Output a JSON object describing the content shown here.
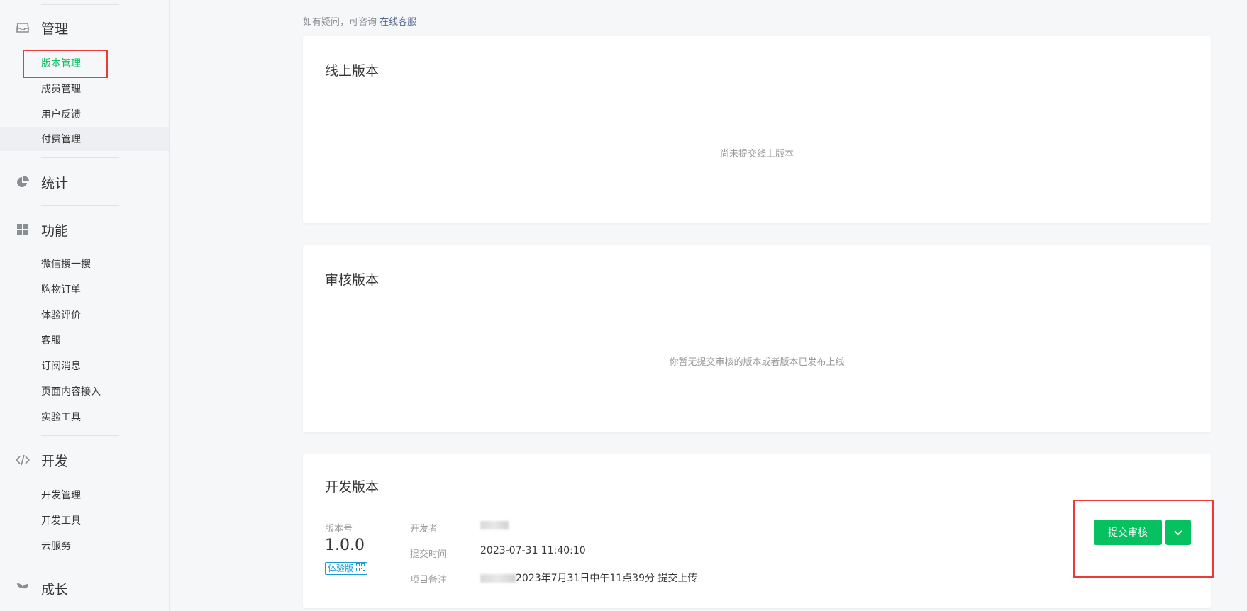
{
  "sidebar": {
    "sections": {
      "manage": {
        "title": "管理",
        "icon": "inbox-icon"
      },
      "stats": {
        "title": "统计",
        "icon": "pie-chart-icon"
      },
      "features": {
        "title": "功能",
        "icon": "grid-icon"
      },
      "dev": {
        "title": "开发",
        "icon": "code-icon"
      },
      "growth": {
        "title": "成长",
        "icon": "sprout-icon"
      }
    },
    "manage_items": [
      "版本管理",
      "成员管理",
      "用户反馈",
      "付费管理"
    ],
    "feature_items": [
      "微信搜一搜",
      "购物订单",
      "体验评价",
      "客服",
      "订阅消息",
      "页面内容接入",
      "实验工具"
    ],
    "dev_items": [
      "开发管理",
      "开发工具",
      "云服务"
    ]
  },
  "notice": {
    "text": "如有疑问，可咨询",
    "link": "在线客服"
  },
  "online": {
    "title": "线上版本",
    "empty": "尚未提交线上版本"
  },
  "review": {
    "title": "审核版本",
    "empty": "你暂无提交审核的版本或者版本已发布上线"
  },
  "dev_version": {
    "title": "开发版本",
    "version_label": "版本号",
    "version": "1.0.0",
    "badge": "体验版",
    "developer_label": "开发者",
    "time_label": "提交时间",
    "time": "2023-07-31 11:40:10",
    "note_label": "项目备注",
    "note": "2023年7月31日中午11点39分 提交上传",
    "submit": "提交审核"
  },
  "colors": {
    "accent": "#07c160",
    "highlight_box": "#ea3a3a",
    "link": "#576b95",
    "badge": "#1a9bd7"
  }
}
